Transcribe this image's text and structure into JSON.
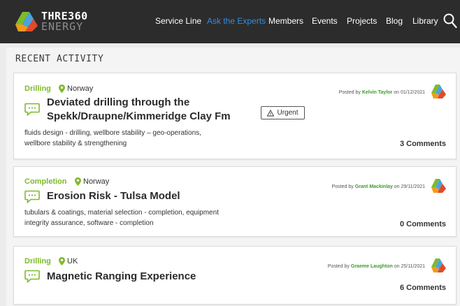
{
  "brand": {
    "line1": "THRE360",
    "line2": "ENERGY"
  },
  "nav": {
    "items": [
      {
        "label": "Service Line",
        "active": false
      },
      {
        "label": "Ask the Experts",
        "active": true
      },
      {
        "label": "Members",
        "active": false
      },
      {
        "label": "Events",
        "active": false
      },
      {
        "label": "Projects",
        "active": false
      },
      {
        "label": "Blog",
        "active": false
      },
      {
        "label": "Library",
        "active": false
      }
    ],
    "search_icon": "search-icon"
  },
  "section": {
    "title": "RECENT ACTIVITY"
  },
  "posts": [
    {
      "category": "Drilling",
      "location": "Norway",
      "title_line1": "Deviated drilling through the",
      "title_line2": "Spekk/Draupne/Kimmeridge Clay Fm",
      "urgent": "Urgent",
      "tags_line1": "fluids design - drilling, wellbore stability – geo-operations,",
      "tags_line2": "wellbore stability & strengthening",
      "posted_prefix": "Posted by",
      "author": "Kelvin Taylor",
      "posted_on": "on 01/12/2021",
      "comments": "3 Comments"
    },
    {
      "category": "Completion",
      "location": "Norway",
      "title_line1": "Erosion Risk - Tulsa Model",
      "tags_line1": "tubulars & coatings, material selection - completion, equipment",
      "tags_line2": "integrity assurance, software - completion",
      "posted_prefix": "Posted by",
      "author": "Grant Mackinlay",
      "posted_on": "on 29/11/2021",
      "comments": "0 Comments"
    },
    {
      "category": "Drilling",
      "location": "UK",
      "title_line1": "Magnetic Ranging Experience",
      "posted_prefix": "Posted by",
      "author": "Graeme Laughton",
      "posted_on": "on 25/11/2021",
      "comments": "6 Comments"
    }
  ],
  "colors": {
    "accent_green": "#7fba2a",
    "nav_bg": "#2c2c2c",
    "active_link": "#2f8fe0",
    "author_green": "#3f9a2f"
  }
}
